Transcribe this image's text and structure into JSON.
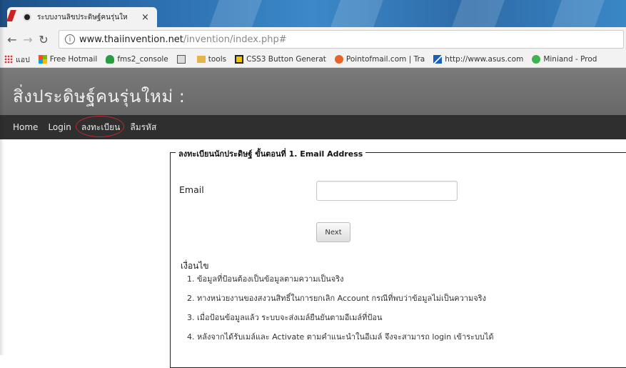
{
  "browser": {
    "tab_title": "ระบบงานลิขประดิษฐ์คนรุ่นให",
    "tab_close": "×",
    "url_host": "www.thaiinvention.net",
    "url_path": "/invention/index.php#"
  },
  "bookmarks": [
    {
      "label": "แอป",
      "icon": "apps-icon",
      "color": "#d33"
    },
    {
      "label": "Free Hotmail",
      "icon": "windows-icon",
      "color": "#f25022"
    },
    {
      "label": "fms2_console",
      "icon": "person-icon",
      "color": "#2a9d44"
    },
    {
      "label": "",
      "icon": "bookmark-icon",
      "color": "#555"
    },
    {
      "label": "tools",
      "icon": "folder-icon",
      "color": "#e3b54b"
    },
    {
      "label": "CSS3 Button Generat",
      "icon": "css-icon",
      "color": "#f0c400"
    },
    {
      "label": "Pointofmail.com | Tra",
      "icon": "circle-icon",
      "color": "#e8622a"
    },
    {
      "label": "http://www.asus.com",
      "icon": "asus-icon",
      "color": "#1a5fb4"
    },
    {
      "label": "Miniand - Prod",
      "icon": "dot-icon",
      "color": "#3fb34f"
    }
  ],
  "site": {
    "title": "สิ่งประดิษฐ์คนรุ่นใหม่ :",
    "nav": [
      "Home",
      "Login",
      "ลงทะเบียน",
      "ลืมรหัส"
    ]
  },
  "form": {
    "legend": "ลงทะเบียนนักประดิษฐ์ ขั้นตอนที่ 1. Email Address",
    "email_label": "Email",
    "email_value": "",
    "next_label": "Next",
    "conditions_title": "เงื่อนไข",
    "conditions": [
      "1. ข้อมูลที่ป้อนต้องเป็นข้อมูลตามความเป็นจริง",
      "2. ทางหน่วยงานของสงวนสิทธิ์ในการยกเลิก Account กรณีที่พบว่าข้อมูลไม่เป็นความจริง",
      "3. เมื่อป้อนข้อมูลแล้ว ระบบจะส่งเมล์ยืนยันตามอีเมล์ที่ป้อน",
      "4. หลังจากได้รับเมล์และ Activate ตามคำแนะนำในอีเมล์ จึงจะสามารถ login เข้าระบบได้"
    ]
  },
  "colors": {
    "header_bg": "#707070",
    "nav_bg": "#2f2f2f",
    "circle_highlight": "#c0262d"
  }
}
